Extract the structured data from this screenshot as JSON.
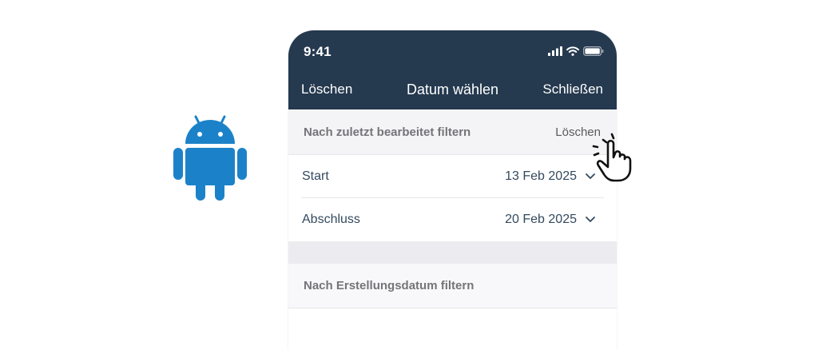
{
  "status_bar": {
    "time": "9:41"
  },
  "nav": {
    "left_label": "Löschen",
    "title": "Datum wählen",
    "right_label": "Schließen"
  },
  "edited_filter": {
    "title": "Nach zuletzt bearbeitet filtern",
    "clear_label": "Löschen",
    "rows": [
      {
        "label": "Start",
        "value": "13 Feb 2025"
      },
      {
        "label": "Abschluss",
        "value": "20 Feb 2025"
      }
    ]
  },
  "created_filter": {
    "title": "Nach Erstellungsdatum filtern"
  },
  "colors": {
    "header_bg": "#25394f",
    "android_blue": "#1b82c9"
  },
  "icons": [
    "android-logo-icon",
    "signal-icon",
    "wifi-icon",
    "battery-icon",
    "chevron-down-icon",
    "pointing-hand-icon"
  ]
}
